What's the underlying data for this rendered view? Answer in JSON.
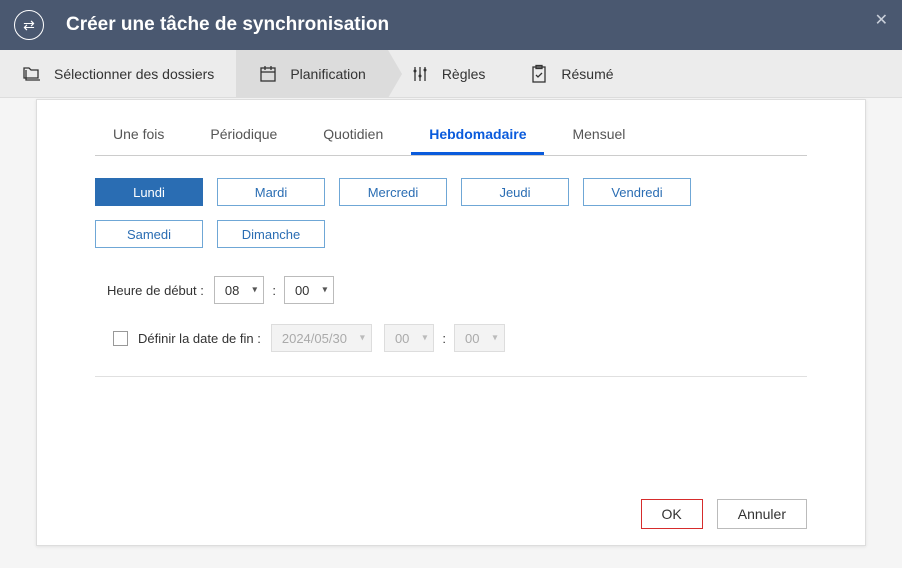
{
  "header": {
    "title": "Créer une tâche de synchronisation"
  },
  "wizard": {
    "steps": [
      {
        "label": "Sélectionner des dossiers",
        "icon": "folders"
      },
      {
        "label": "Planification",
        "icon": "calendar"
      },
      {
        "label": "Règles",
        "icon": "sliders"
      },
      {
        "label": "Résumé",
        "icon": "clipboard"
      }
    ]
  },
  "tabs": {
    "items": [
      "Une fois",
      "Périodique",
      "Quotidien",
      "Hebdomadaire",
      "Mensuel"
    ],
    "active_index": 3
  },
  "days": {
    "items": [
      "Lundi",
      "Mardi",
      "Mercredi",
      "Jeudi",
      "Vendredi",
      "Samedi",
      "Dimanche"
    ],
    "selected_index": 0
  },
  "start_time": {
    "label": "Heure de début :",
    "hour": "08",
    "minute": "00"
  },
  "end_date": {
    "label": "Définir la date de fin :",
    "checked": false,
    "date": "2024/05/30",
    "hour": "00",
    "minute": "00"
  },
  "footer": {
    "ok": "OK",
    "cancel": "Annuler"
  }
}
